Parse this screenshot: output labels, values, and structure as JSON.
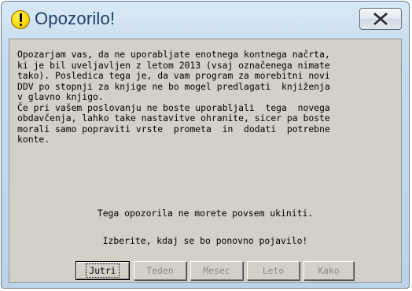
{
  "window": {
    "title": "Opozorilo!"
  },
  "message": {
    "lines": [
      "Opozarjam vas, da ne uporabljate enotnega kontnega načrta,",
      "ki je bil uveljavljen z letom 2013 (vsaj označenega nimate",
      "tako). Posledica tega je, da vam program za morebitni novi",
      "DDV po stopnji za knjige ne bo mogel predlagati  knjiženja",
      "v glavno knjigo.",
      "Če pri vašem poslovanju ne boste uporabljali  tega  novega",
      "obdavčenja, lahko take nastavitve ohranite, sicer pa boste",
      "morali samo popraviti vrste  prometa  in  dodati  potrebne",
      "konte."
    ],
    "cannot_disable": "Tega opozorila ne morete povsem ukiniti.",
    "choose_when": "Izberite, kdaj se bo ponovno pojavilo!"
  },
  "buttons": {
    "tomorrow": "Jutri",
    "week": "Teden",
    "month": "Mesec",
    "year": "Leto",
    "how": "Kako"
  },
  "icons": {
    "title_icon": "warning-exclamation-icon",
    "close_icon": "close-x-icon"
  },
  "colors": {
    "title_text": "#1e3f66",
    "dialog_face": "#d4d0c8",
    "warning_yellow": "#ffd800",
    "disabled_text": "#8a8a8a"
  }
}
